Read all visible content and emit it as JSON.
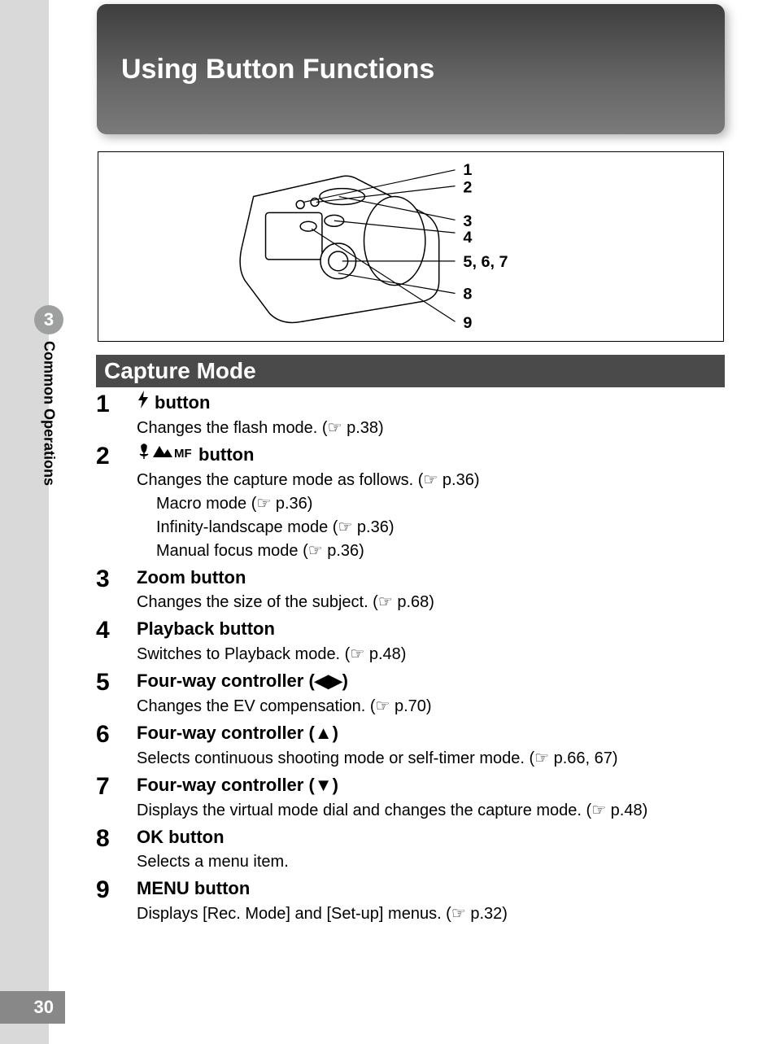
{
  "page_number": "30",
  "chapter_number": "3",
  "chapter_label": "Common Operations",
  "header_title": "Using Button Functions",
  "section_title": "Capture Mode",
  "diagram_labels": [
    "1",
    "2",
    "3",
    "4",
    "5, 6, 7",
    "8",
    "9"
  ],
  "items": [
    {
      "num": "1",
      "title_prefix_icon": "flash-icon",
      "title": " button",
      "desc": "Changes the flash mode. (☞ p.38)"
    },
    {
      "num": "2",
      "title_prefix_icon": "focus-modes-icon",
      "title": " button",
      "desc": "Changes the capture mode as follows. (☞ p.36)",
      "sub": [
        "Macro mode (☞ p.36)",
        "Infinity-landscape mode (☞ p.36)",
        "Manual focus mode (☞ p.36)"
      ]
    },
    {
      "num": "3",
      "title": "Zoom button",
      "desc": "Changes the size of the subject. (☞ p.68)"
    },
    {
      "num": "4",
      "title": "Playback button",
      "desc": "Switches to Playback mode. (☞ p.48)"
    },
    {
      "num": "5",
      "title": "Four-way controller (◀▶)",
      "desc": "Changes the EV compensation. (☞ p.70)"
    },
    {
      "num": "6",
      "title": "Four-way controller (▲)",
      "desc": "Selects continuous shooting mode or self-timer mode. (☞ p.66, 67)"
    },
    {
      "num": "7",
      "title": "Four-way controller (▼)",
      "desc": "Displays the virtual mode dial and changes the capture mode. (☞ p.48)"
    },
    {
      "num": "8",
      "title": "OK button",
      "desc": "Selects a menu item."
    },
    {
      "num": "9",
      "title": "MENU button",
      "desc": "Displays [Rec. Mode] and [Set-up] menus. (☞ p.32)"
    }
  ]
}
